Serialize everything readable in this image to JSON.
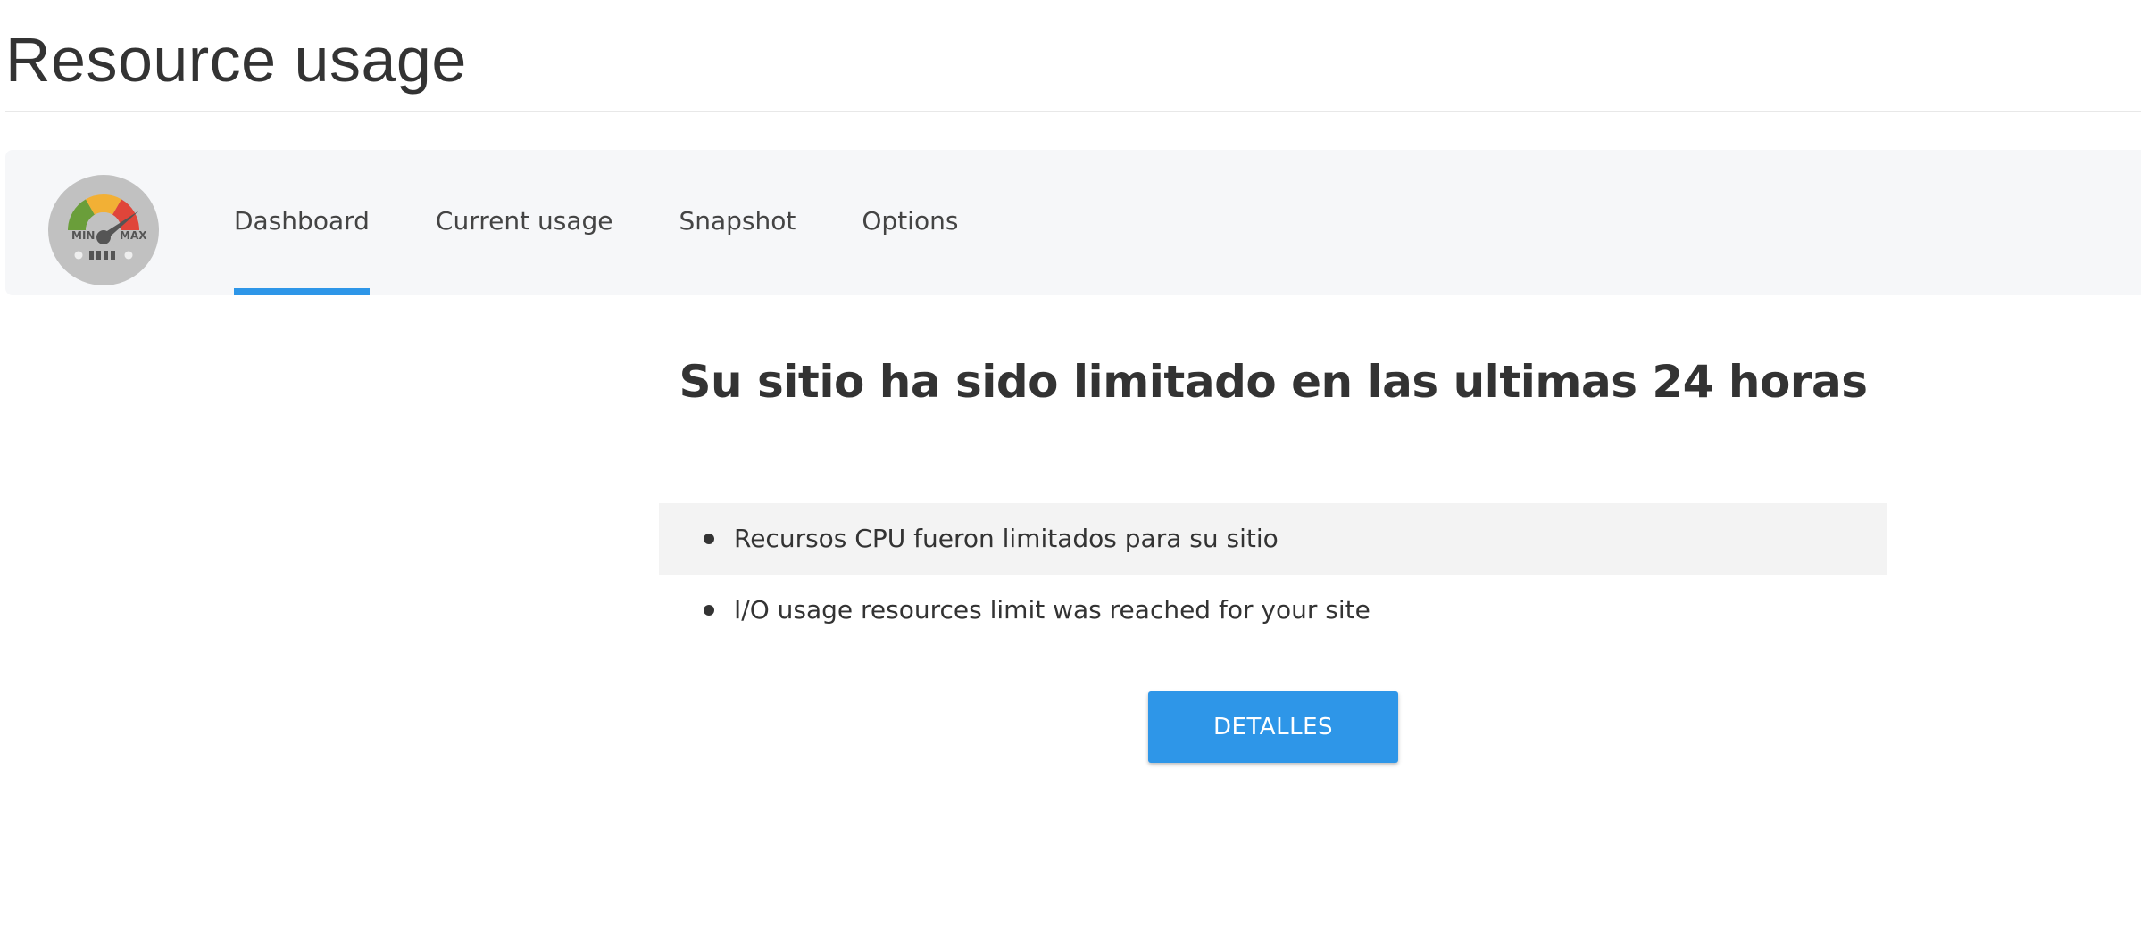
{
  "page": {
    "title": "Resource usage"
  },
  "logo": {
    "icon": "gauge-icon",
    "min_label": "MIN",
    "max_label": "MAX"
  },
  "tabs": [
    {
      "label": "Dashboard",
      "active": true
    },
    {
      "label": "Current usage",
      "active": false
    },
    {
      "label": "Snapshot",
      "active": false
    },
    {
      "label": "Options",
      "active": false
    }
  ],
  "main": {
    "headline": "Su sitio ha sido limitado en las ultimas 24 horas",
    "limits": [
      "Recursos CPU fueron limitados para su sitio",
      "I/O usage resources limit was reached for your site"
    ],
    "details_button_label": "DETALLES"
  },
  "colors": {
    "accent": "#2e96e8",
    "tabbar_bg": "#f6f7f9",
    "gauge_green": "#6a9e3a",
    "gauge_yellow": "#f2b035",
    "gauge_red": "#e0453a"
  }
}
